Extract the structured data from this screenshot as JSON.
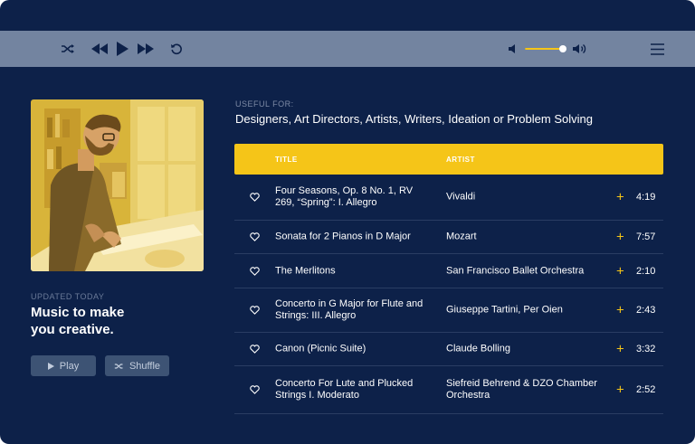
{
  "player": {
    "controls": [
      "shuffle-icon",
      "previous-icon",
      "play-icon",
      "next-icon",
      "repeat-icon"
    ],
    "volume_level": 0.92,
    "menu_icon": "menu-icon"
  },
  "sidebar": {
    "updated": "UPDATED TODAY",
    "headline_line1": "Music to make",
    "headline_line2": "you creative.",
    "play_label": "Play",
    "shuffle_label": "Shuffle"
  },
  "main": {
    "useful_label": "USEFUL FOR:",
    "useful_text": "Designers, Art Directors, Artists, Writers, Ideation or Problem Solving",
    "columns": {
      "title": "TITLE",
      "artist": "ARTIST"
    },
    "tracks": [
      {
        "title": "Four Seasons, Op. 8 No. 1, RV 269, “Spring”: I. Allegro",
        "artist": "Vivaldi",
        "duration": "4:19"
      },
      {
        "title": "Sonata for 2 Pianos in D Major",
        "artist": "Mozart",
        "duration": "7:57"
      },
      {
        "title": "The Merlitons",
        "artist": "San Francisco Ballet Orchestra",
        "duration": "2:10"
      },
      {
        "title": "Concerto in G Major for Flute and Strings: III. Allegro",
        "artist": "Giuseppe Tartini, Per Oien",
        "duration": "2:43"
      },
      {
        "title": "Canon (Picnic Suite)",
        "artist": "Claude Bolling",
        "duration": "3:32"
      },
      {
        "title": "Concerto For Lute and Plucked Strings I. Moderato",
        "artist": "Siefreid Behrend & DZO Chamber Orchestra",
        "duration": "2:52"
      }
    ]
  },
  "colors": {
    "background": "#0d2149",
    "player_bar": "#7384a0",
    "accent": "#f5c518",
    "button": "#3d5374"
  }
}
